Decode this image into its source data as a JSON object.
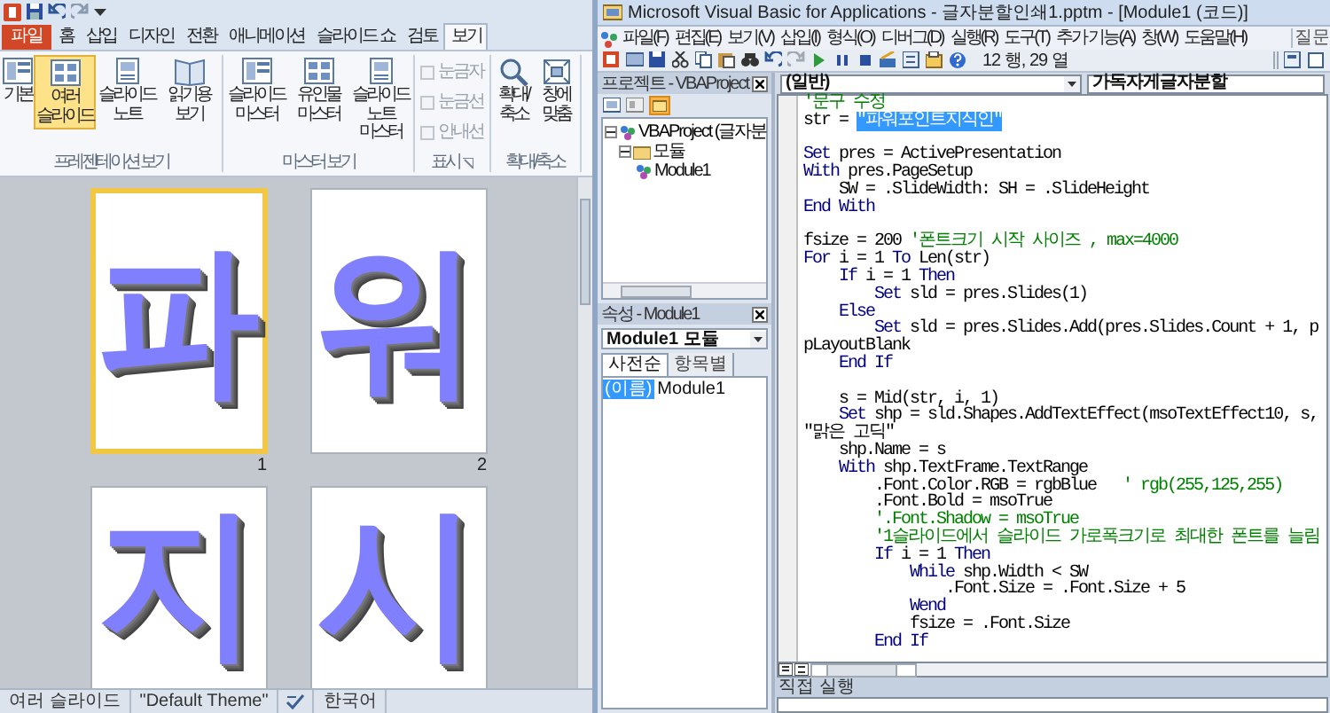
{
  "powerpoint": {
    "tabs": [
      {
        "label": "파일",
        "kind": "file",
        "selected": false
      },
      {
        "label": "홈",
        "kind": "tab",
        "selected": false
      },
      {
        "label": "삽입",
        "kind": "tab",
        "selected": false
      },
      {
        "label": "디자인",
        "kind": "tab",
        "selected": false
      },
      {
        "label": "전환",
        "kind": "tab",
        "selected": false
      },
      {
        "label": "애니메이션",
        "kind": "tab",
        "selected": false
      },
      {
        "label": "슬라이드 쇼",
        "kind": "tab",
        "selected": false
      },
      {
        "label": "검토",
        "kind": "tab",
        "selected": false
      },
      {
        "label": "보기",
        "kind": "tab",
        "selected": true
      }
    ],
    "ribbon_groups": [
      {
        "label": "프레젠테이션 보기",
        "items": [
          {
            "kind": "button",
            "label": "기본",
            "selected": false
          },
          {
            "kind": "button",
            "label": "여러 슬라이드",
            "selected": true
          },
          {
            "kind": "button",
            "label": "슬라이드 노트",
            "selected": false
          },
          {
            "kind": "button",
            "label": "읽기용 보기",
            "selected": false
          }
        ]
      },
      {
        "label": "마스터 보기",
        "items": [
          {
            "kind": "button",
            "label": "슬라이드 마스터",
            "selected": false
          },
          {
            "kind": "button",
            "label": "유인물 마스터",
            "selected": false
          },
          {
            "kind": "button",
            "label": "슬라이드 노트 마스터",
            "selected": false
          }
        ]
      },
      {
        "label": "표시",
        "items": [
          {
            "kind": "checkbox",
            "label": "눈금자",
            "checked": false,
            "disabled": true
          },
          {
            "kind": "checkbox",
            "label": "눈금선",
            "checked": false,
            "disabled": true
          },
          {
            "kind": "checkbox",
            "label": "안내선",
            "checked": false,
            "disabled": true
          }
        ]
      },
      {
        "label": "확대/축소",
        "items": [
          {
            "kind": "button",
            "label": "확대/축소",
            "selected": false
          },
          {
            "kind": "button",
            "label": "창에 맞춤",
            "selected": false
          }
        ]
      }
    ],
    "slides": [
      {
        "letter": "파",
        "number": "1",
        "selected": true
      },
      {
        "letter": "워",
        "number": "2",
        "selected": false
      },
      {
        "letter": "지",
        "selected": false
      },
      {
        "letter": "시",
        "selected": false
      }
    ],
    "status_bar": [
      "여러 슬라이드",
      "\"Default Theme\"",
      "한국어"
    ]
  },
  "vba": {
    "title": "Microsoft Visual Basic for Applications - 글자분할인쇄1.pptm - [Module1 (코드)]",
    "menu": [
      "파일(F)",
      "편집(E)",
      "보기(V)",
      "삽입(I)",
      "형식(O)",
      "디버그(D)",
      "실행(R)",
      "도구(T)",
      "추가 기능(A)",
      "창(W)",
      "도움말(H)"
    ],
    "help_search": {
      "placeholder": "질문"
    },
    "cursor_position": "12 행, 29 열",
    "project": {
      "title": "프로젝트 - VBAProject",
      "tree": [
        {
          "label": "VBAProject (글자분",
          "expanded": true,
          "children": [
            {
              "label": "모듈",
              "expanded": true,
              "children": [
                {
                  "label": "Module1"
                }
              ]
            }
          ]
        }
      ]
    },
    "properties": {
      "title": "속성 - Module1",
      "object": "Module1 모듈",
      "tabs": [
        {
          "label": "사전순",
          "selected": true
        },
        {
          "label": "항목별",
          "selected": false
        }
      ],
      "rows": [
        {
          "name": "(이름)",
          "value": "Module1",
          "selected": true
        }
      ]
    },
    "code": {
      "object": "(일반)",
      "procedure": "가독자게글자분할",
      "lines": [
        {
          "kind": "code",
          "parts": [
            {
              "kind": "comment",
              "text": "'문구 수정"
            }
          ]
        },
        {
          "kind": "code",
          "parts": [
            {
              "kind": "code",
              "text": "str = "
            },
            {
              "kind": "selection",
              "text": "\"파워포인트지식인\""
            }
          ]
        },
        {
          "kind": "blank"
        },
        {
          "kind": "code",
          "parts": [
            {
              "kind": "keyword",
              "text": "Set"
            },
            {
              "kind": "code",
              "text": " pres = ActivePresentation"
            }
          ]
        },
        {
          "kind": "code",
          "parts": [
            {
              "kind": "keyword",
              "text": "With"
            },
            {
              "kind": "code",
              "text": " pres.PageSetup"
            }
          ]
        },
        {
          "kind": "code",
          "parts": [
            {
              "kind": "code",
              "text": "    SW = .SlideWidth: SH = .SlideHeight"
            }
          ]
        },
        {
          "kind": "code",
          "parts": [
            {
              "kind": "keyword",
              "text": "End With"
            }
          ]
        },
        {
          "kind": "blank"
        },
        {
          "kind": "code",
          "parts": [
            {
              "kind": "code",
              "text": "fsize = 200 "
            },
            {
              "kind": "comment",
              "text": "'폰트크기 시작 사이즈 , max=4000"
            }
          ]
        },
        {
          "kind": "code",
          "parts": [
            {
              "kind": "keyword",
              "text": "For"
            },
            {
              "kind": "code",
              "text": " i = 1 "
            },
            {
              "kind": "keyword",
              "text": "To"
            },
            {
              "kind": "code",
              "text": " Len(str)"
            }
          ]
        },
        {
          "kind": "code",
          "parts": [
            {
              "kind": "keyword",
              "text": "    If"
            },
            {
              "kind": "code",
              "text": " i = 1 "
            },
            {
              "kind": "keyword",
              "text": "Then"
            }
          ]
        },
        {
          "kind": "code",
          "parts": [
            {
              "kind": "keyword",
              "text": "        Set"
            },
            {
              "kind": "code",
              "text": " sld = pres.Slides(1)"
            }
          ]
        },
        {
          "kind": "code",
          "parts": [
            {
              "kind": "keyword",
              "text": "    Else"
            }
          ]
        },
        {
          "kind": "code",
          "parts": [
            {
              "kind": "keyword",
              "text": "        Set"
            },
            {
              "kind": "code",
              "text": " sld = pres.Slides.Add(pres.Slides.Count + 1, ppLayoutBlank"
            }
          ]
        },
        {
          "kind": "code",
          "parts": [
            {
              "kind": "keyword",
              "text": "    End If"
            }
          ]
        },
        {
          "kind": "blank"
        },
        {
          "kind": "code",
          "parts": [
            {
              "kind": "code",
              "text": "    s = Mid(str, i, 1)"
            }
          ]
        },
        {
          "kind": "code",
          "parts": [
            {
              "kind": "keyword",
              "text": "    Set"
            },
            {
              "kind": "code",
              "text": " shp = sld.Shapes.AddTextEffect(msoTextEffect10, s, \"맑은 고딕\""
            }
          ]
        },
        {
          "kind": "code",
          "parts": [
            {
              "kind": "code",
              "text": "    shp.Name = s"
            }
          ]
        },
        {
          "kind": "code",
          "parts": [
            {
              "kind": "keyword",
              "text": "    With"
            },
            {
              "kind": "code",
              "text": " shp.TextFrame.TextRange"
            }
          ]
        },
        {
          "kind": "code",
          "parts": [
            {
              "kind": "code",
              "text": "        .Font.Color.RGB = rgbBlue   "
            },
            {
              "kind": "comment",
              "text": "' rgb(255,125,255)"
            }
          ]
        },
        {
          "kind": "code",
          "parts": [
            {
              "kind": "code",
              "text": "        .Font.Bold = msoTrue"
            }
          ]
        },
        {
          "kind": "code",
          "parts": [
            {
              "kind": "comment",
              "text": "        '.Font.Shadow = msoTrue"
            }
          ]
        },
        {
          "kind": "code",
          "parts": [
            {
              "kind": "comment",
              "text": "        '1슬라이드에서 슬라이드 가로폭크기로 최대한 폰트를 늘림"
            }
          ]
        },
        {
          "kind": "code",
          "parts": [
            {
              "kind": "keyword",
              "text": "        If"
            },
            {
              "kind": "code",
              "text": " i = 1 "
            },
            {
              "kind": "keyword",
              "text": "Then"
            }
          ]
        },
        {
          "kind": "code",
          "parts": [
            {
              "kind": "keyword",
              "text": "            While"
            },
            {
              "kind": "code",
              "text": " shp.Width < SW"
            }
          ]
        },
        {
          "kind": "code",
          "parts": [
            {
              "kind": "code",
              "text": "                .Font.Size = .Font.Size + 5"
            }
          ]
        },
        {
          "kind": "code",
          "parts": [
            {
              "kind": "keyword",
              "text": "            Wend"
            }
          ]
        },
        {
          "kind": "code",
          "parts": [
            {
              "kind": "code",
              "text": "            fsize = .Font.Size"
            }
          ]
        },
        {
          "kind": "code",
          "parts": [
            {
              "kind": "keyword",
              "text": "        End If"
            }
          ]
        }
      ]
    },
    "immediate": {
      "title": "직접 실행"
    }
  }
}
